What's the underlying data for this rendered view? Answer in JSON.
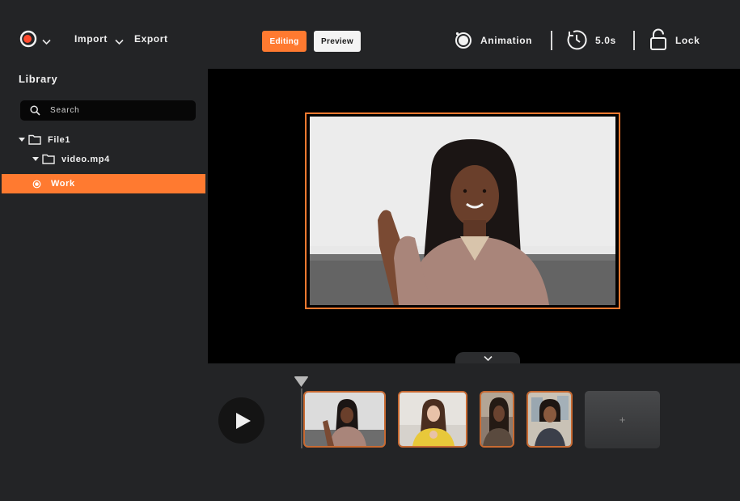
{
  "header": {
    "import_label": "Import",
    "export_label": "Export",
    "modes": {
      "editing": "Editing",
      "preview": "Preview"
    },
    "tools": {
      "animation": "Animation",
      "duration": "5.0s",
      "lock": "Lock"
    }
  },
  "library": {
    "title": "Library",
    "search_placeholder": "Search",
    "tree": {
      "folder": "File1",
      "subfolder": "video.mp4",
      "selected_item": "Work"
    }
  },
  "timeline": {
    "add_clip_label": "+"
  },
  "colors": {
    "accent": "#ff7a30",
    "background": "#232426",
    "stage": "#000000"
  },
  "icons": {
    "logo": "record-logo-icon",
    "chevron": "chevron-down-icon",
    "animation": "animation-ring-icon",
    "duration": "timer-icon",
    "lock": "lock-icon",
    "search": "search-icon",
    "folder": "folder-icon",
    "play": "play-icon"
  }
}
